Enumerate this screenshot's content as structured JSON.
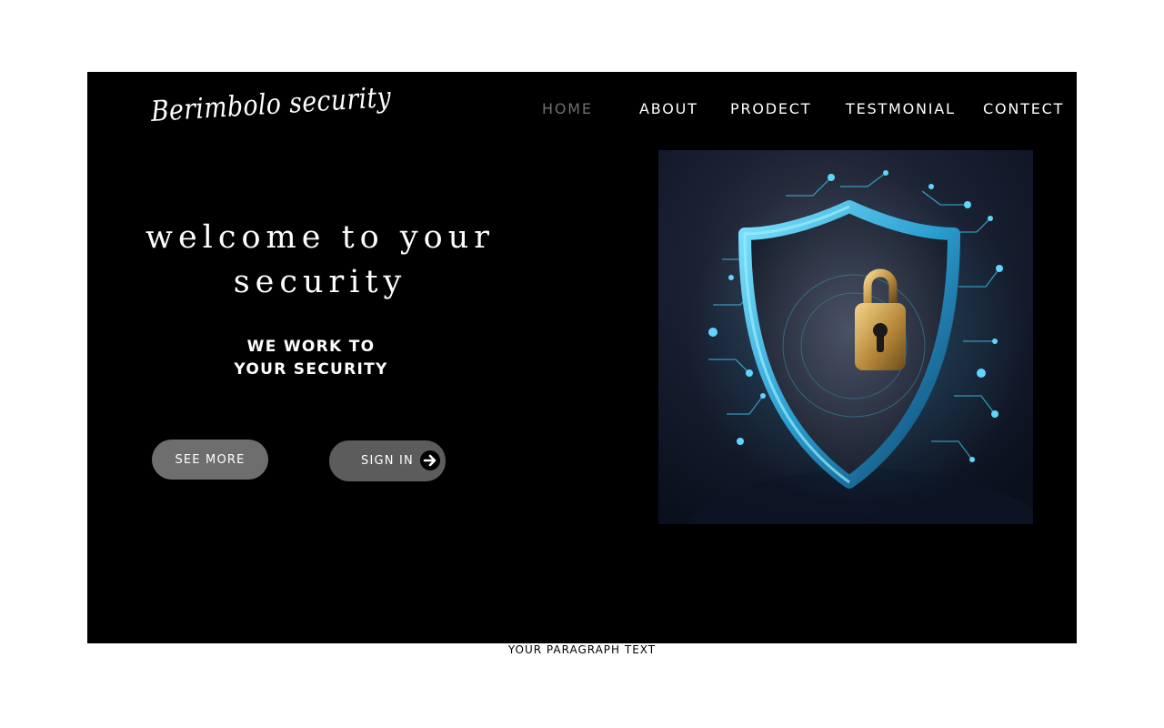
{
  "brand": {
    "logo_text": "Berimbolo security"
  },
  "nav": {
    "items": [
      {
        "label": "HOME",
        "active": true
      },
      {
        "label": "ABOUT",
        "active": false
      },
      {
        "label": "PRODECT",
        "active": false
      },
      {
        "label": "TESTMONIAL",
        "active": false
      },
      {
        "label": "CONTECT",
        "active": false
      }
    ]
  },
  "hero": {
    "title": "welcome to your security",
    "subtitle": "WE WORK  TO\nYOUR SECURITY",
    "buttons": {
      "see_more": "SEE MORE",
      "sign_in": "SIGN IN"
    },
    "image_icon": "shield-padlock-icon"
  },
  "footer": {
    "paragraph": "YOUR PARAGRAPH TEXT"
  },
  "colors": {
    "page_background": "#ffffff",
    "frame_background": "#000000",
    "nav_active": "#6f6f6f",
    "button_background": "#6e6e6e",
    "accent_cyan": "#3ec8f0"
  }
}
